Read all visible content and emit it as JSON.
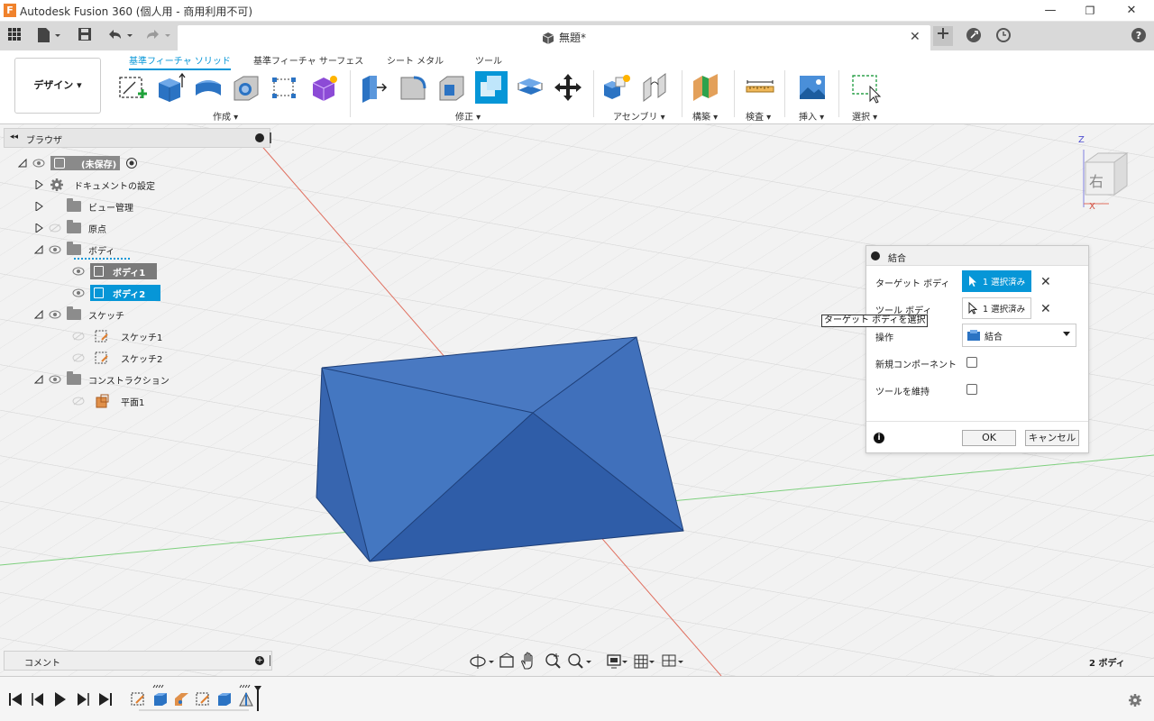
{
  "window": {
    "app_icon_letter": "F",
    "title": "Autodesk Fusion 360 (個人用 - 商用利用不可)",
    "minimize": "—",
    "restore": "❐",
    "close": "✕"
  },
  "document": {
    "title": "無題*",
    "close_glyph": "✕"
  },
  "ribbon": {
    "workspace": "デザイン ▾",
    "tabs": [
      {
        "label": "基準フィーチャ ソリッド",
        "active": true
      },
      {
        "label": "基準フィーチャ サーフェス",
        "active": false
      },
      {
        "label": "シート メタル",
        "active": false
      },
      {
        "label": "ツール",
        "active": false
      }
    ],
    "groups": {
      "create": "作成 ▾",
      "modify": "修正 ▾",
      "assemble": "アセンブリ ▾",
      "construct": "構築 ▾",
      "inspect": "検査 ▾",
      "insert": "挿入 ▾",
      "select": "選択 ▾"
    }
  },
  "browser": {
    "title": "ブラウザ",
    "root_label": "(未保存)",
    "items": {
      "doc_settings": "ドキュメントの設定",
      "named_views": "ビュー管理",
      "origin": "原点",
      "bodies": "ボディ",
      "body1": "ボディ1",
      "body2": "ボディ2",
      "sketches": "スケッチ",
      "sketch1": "スケッチ1",
      "sketch2": "スケッチ2",
      "construction": "コンストラクション",
      "plane1": "平面1"
    }
  },
  "view_cube": {
    "face_label": "右",
    "axis_z": "Z",
    "axis_x": "X"
  },
  "dialog": {
    "title": "結合",
    "target_body_label": "ターゲット ボディ",
    "target_body_value": "1 選択済み",
    "tool_body_label": "ツール ボディ",
    "tool_body_value": "1 選択済み",
    "operation_label": "操作",
    "operation_value": "結合",
    "new_component_label": "新規コンポーネント",
    "keep_tools_label": "ツールを維持",
    "new_component_checked": false,
    "keep_tools_checked": false,
    "ok": "OK",
    "cancel": "キャンセル",
    "clear_glyph": "✕",
    "info_glyph": "i"
  },
  "tooltip": "ターゲット ボディを選択",
  "comments": {
    "label": "コメント"
  },
  "status": {
    "body_count": "2 ボディ"
  },
  "colors": {
    "accent": "#0696d7",
    "body_fill": "#3f6fb8",
    "body_dark": "#2d5aa0",
    "selection": "#0696d7",
    "grid": "#d6d6d6"
  }
}
